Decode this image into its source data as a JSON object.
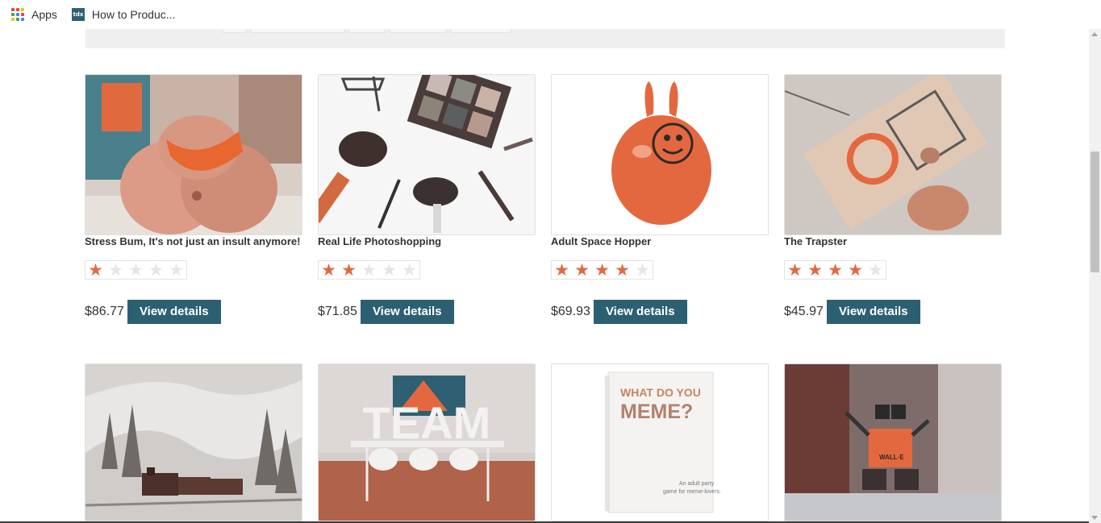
{
  "bookmarks": {
    "apps_label": "Apps",
    "tab_label": "How to Produc...",
    "favicon_text": "tdx"
  },
  "colors": {
    "accent": "#e4683f",
    "button": "#2d5f73"
  },
  "products": [
    {
      "title": "Stress Bum, It's not just an insult anymore!",
      "rating": 1,
      "price": "$86.77",
      "button_label": "View details",
      "image": "stress-bum-image"
    },
    {
      "title": "Real Life Photoshopping",
      "rating": 2,
      "price": "$71.85",
      "button_label": "View details",
      "image": "makeup-brushes-image"
    },
    {
      "title": "Adult Space Hopper",
      "rating": 4,
      "price": "$69.93",
      "button_label": "View details",
      "image": "space-hopper-image"
    },
    {
      "title": "The Trapster",
      "rating": 4,
      "price": "$45.97",
      "button_label": "View details",
      "image": "mouse-trap-image"
    },
    {
      "title": "",
      "rating": null,
      "price": "",
      "button_label": "",
      "image": "steam-train-image"
    },
    {
      "title": "",
      "rating": null,
      "price": "",
      "button_label": "",
      "image": "team-letters-image"
    },
    {
      "title": "",
      "rating": null,
      "price": "",
      "button_label": "",
      "image": "meme-card-game-image"
    },
    {
      "title": "",
      "rating": null,
      "price": "",
      "button_label": "",
      "image": "robot-toy-image"
    }
  ],
  "images": {
    "meme_box_title": "WHAT DO YOU MEME?",
    "meme_box_line1": "WHAT DO YOU",
    "meme_box_line2": "MEME?",
    "meme_box_sub1": "An adult party",
    "meme_box_sub2": "game for meme-lovers.",
    "team_word": "TEAM",
    "robot_label": "WALL·E"
  }
}
